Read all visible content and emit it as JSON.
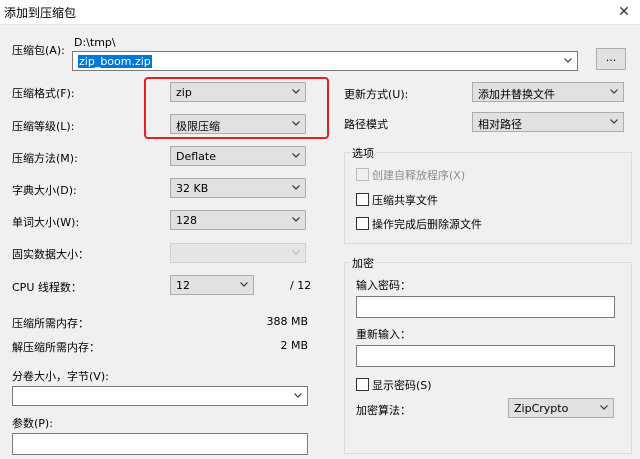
{
  "window": {
    "title": "添加到压缩包",
    "close_glyph": "✕"
  },
  "archive": {
    "label": "压缩包(A):",
    "path": "D:\\tmp\\",
    "filename": "zip_boom.zip",
    "browse_label": "..."
  },
  "left": {
    "format": {
      "label": "压缩格式(F):",
      "value": "zip"
    },
    "level": {
      "label": "压缩等级(L):",
      "value": "极限压缩"
    },
    "method": {
      "label": "压缩方法(M):",
      "value": "Deflate"
    },
    "dict": {
      "label": "字典大小(D):",
      "value": "32 KB"
    },
    "word": {
      "label": "单词大小(W):",
      "value": "128"
    },
    "solid": {
      "label": "固实数据大小：",
      "value": ""
    },
    "cpu": {
      "label": "CPU 线程数：",
      "value": "12",
      "total": "/ 12"
    },
    "mem_compress": {
      "label": "压缩所需内存：",
      "value": "388 MB"
    },
    "mem_decompress": {
      "label": "解压缩所需内存：",
      "value": "2 MB"
    },
    "split": {
      "label": "分卷大小，字节(V):",
      "value": ""
    },
    "params": {
      "label": "参数(P):",
      "value": ""
    }
  },
  "right": {
    "update": {
      "label": "更新方式(U):",
      "value": "添加并替换文件"
    },
    "pathmode": {
      "label": "路径模式",
      "value": "相对路径"
    },
    "options": {
      "title": "选项",
      "sfx": "创建自释放程序(X)",
      "shared": "压缩共享文件",
      "delete": "操作完成后删除源文件"
    },
    "encryption": {
      "title": "加密",
      "password_label": "输入密码：",
      "reenter_label": "重新输入：",
      "show_password": "显示密码(S)",
      "method_label": "加密算法：",
      "method_value": "ZipCrypto"
    }
  },
  "colors": {
    "highlight": "#e32020",
    "selection": "#0078d7"
  }
}
